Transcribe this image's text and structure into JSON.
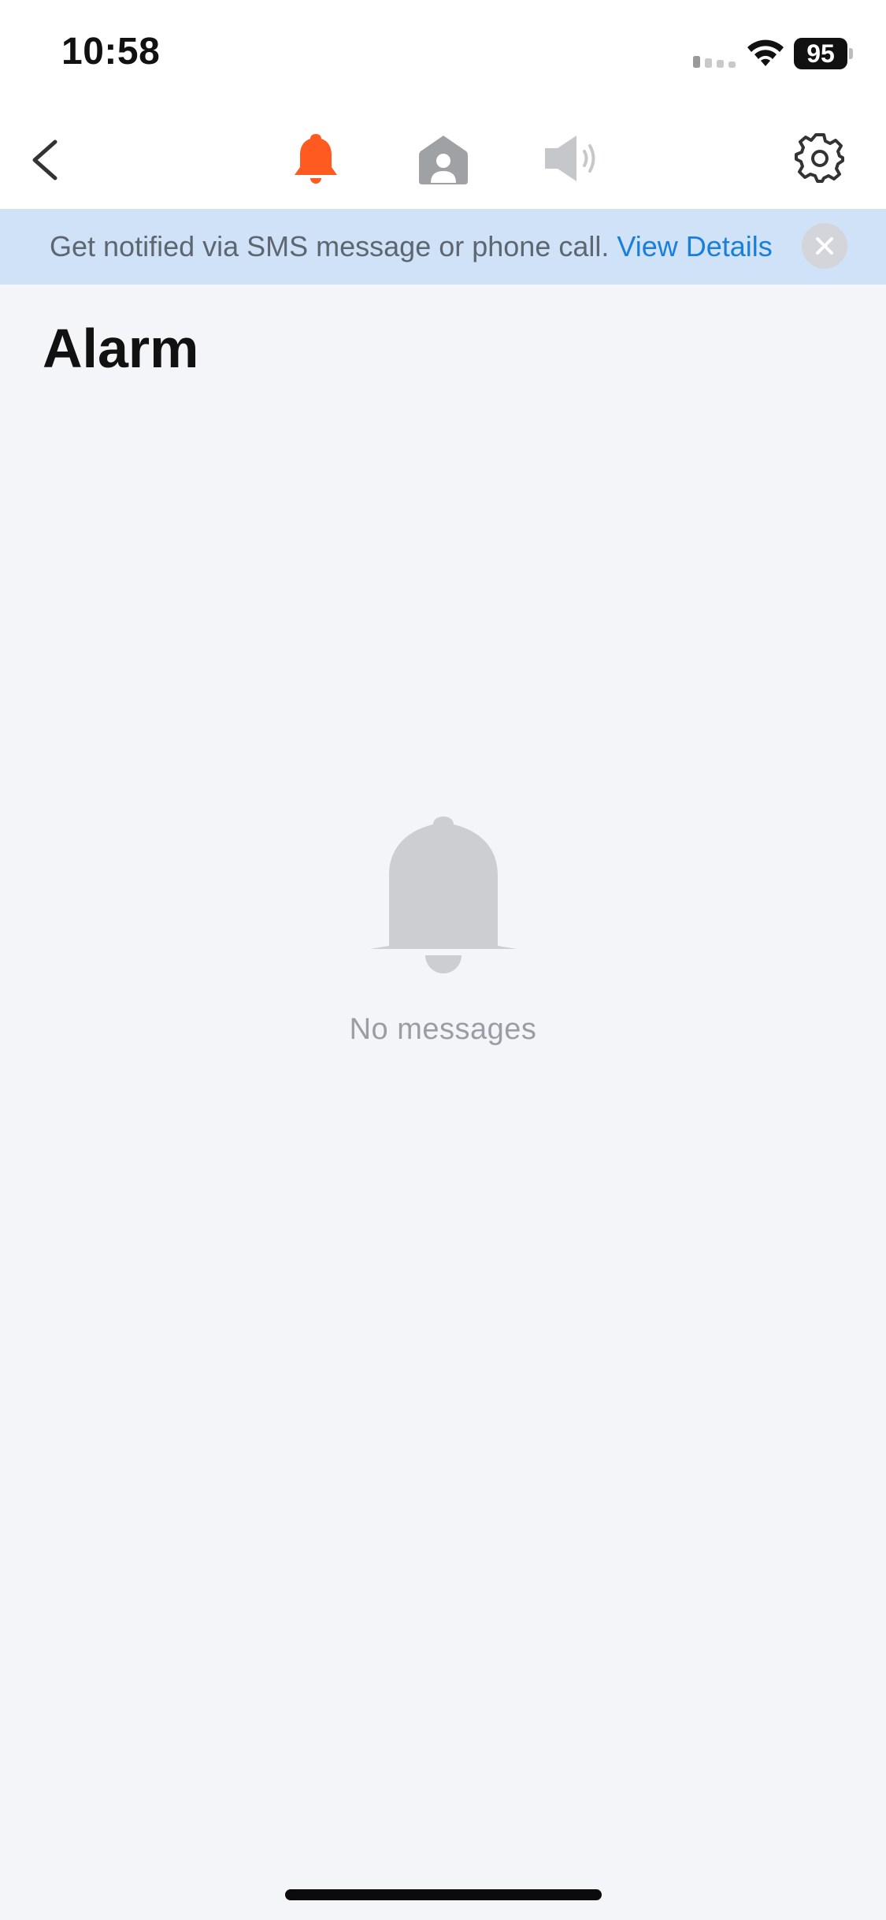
{
  "status_bar": {
    "time": "10:58",
    "battery_level": "95",
    "signal_icon": "cellular-signal-icon",
    "wifi_icon": "wifi-icon"
  },
  "nav": {
    "back_icon": "chevron-left-icon",
    "tabs": [
      {
        "icon": "bell-icon",
        "active": true
      },
      {
        "icon": "home-person-icon",
        "active": false
      },
      {
        "icon": "speaker-icon",
        "active": false
      }
    ],
    "settings_icon": "gear-icon"
  },
  "banner": {
    "message": "Get notified via SMS message or phone call. ",
    "link_text": "View Details",
    "close_icon": "close-icon"
  },
  "page": {
    "title": "Alarm"
  },
  "empty_state": {
    "icon": "bell-icon",
    "text": "No messages"
  },
  "colors": {
    "accent": "#FF5A1F",
    "link": "#1A7FD9",
    "banner_bg": "#CFE2F7",
    "page_bg": "#F3F5F9",
    "inactive_icon": "#9FA1A4"
  }
}
